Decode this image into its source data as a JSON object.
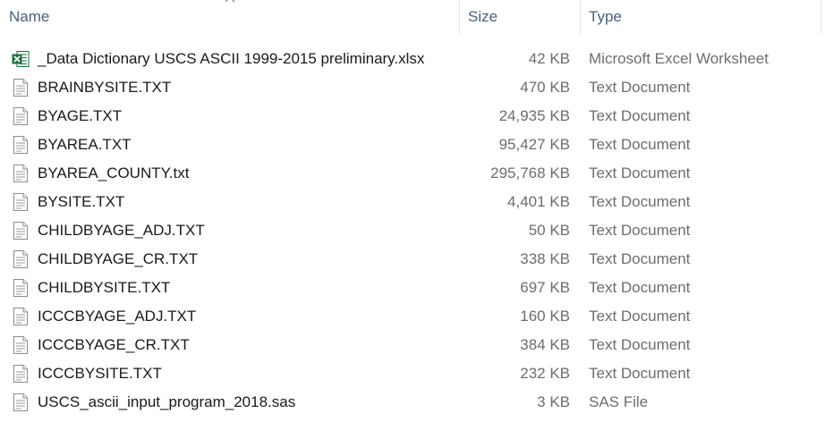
{
  "columns": {
    "name": "Name",
    "size": "Size",
    "type": "Type"
  },
  "files": [
    {
      "name": "_Data Dictionary USCS ASCII 1999-2015 preliminary.xlsx",
      "size": "42 KB",
      "type": "Microsoft Excel Worksheet",
      "icon": "excel-file-icon"
    },
    {
      "name": "BRAINBYSITE.TXT",
      "size": "470 KB",
      "type": "Text Document",
      "icon": "text-file-icon"
    },
    {
      "name": "BYAGE.TXT",
      "size": "24,935 KB",
      "type": "Text Document",
      "icon": "text-file-icon"
    },
    {
      "name": "BYAREA.TXT",
      "size": "95,427 KB",
      "type": "Text Document",
      "icon": "text-file-icon"
    },
    {
      "name": "BYAREA_COUNTY.txt",
      "size": "295,768 KB",
      "type": "Text Document",
      "icon": "text-file-icon"
    },
    {
      "name": "BYSITE.TXT",
      "size": "4,401 KB",
      "type": "Text Document",
      "icon": "text-file-icon"
    },
    {
      "name": "CHILDBYAGE_ADJ.TXT",
      "size": "50 KB",
      "type": "Text Document",
      "icon": "text-file-icon"
    },
    {
      "name": "CHILDBYAGE_CR.TXT",
      "size": "338 KB",
      "type": "Text Document",
      "icon": "text-file-icon"
    },
    {
      "name": "CHILDBYSITE.TXT",
      "size": "697 KB",
      "type": "Text Document",
      "icon": "text-file-icon"
    },
    {
      "name": "ICCCBYAGE_ADJ.TXT",
      "size": "160 KB",
      "type": "Text Document",
      "icon": "text-file-icon"
    },
    {
      "name": "ICCCBYAGE_CR.TXT",
      "size": "384 KB",
      "type": "Text Document",
      "icon": "text-file-icon"
    },
    {
      "name": "ICCCBYSITE.TXT",
      "size": "232 KB",
      "type": "Text Document",
      "icon": "text-file-icon"
    },
    {
      "name": "USCS_ascii_input_program_2018.sas",
      "size": "3 KB",
      "type": "SAS File",
      "icon": "sas-file-icon"
    }
  ],
  "colors": {
    "header_text": "#4c607a",
    "secondary_text": "#6d6d6d",
    "excel_green": "#1d6f42"
  }
}
